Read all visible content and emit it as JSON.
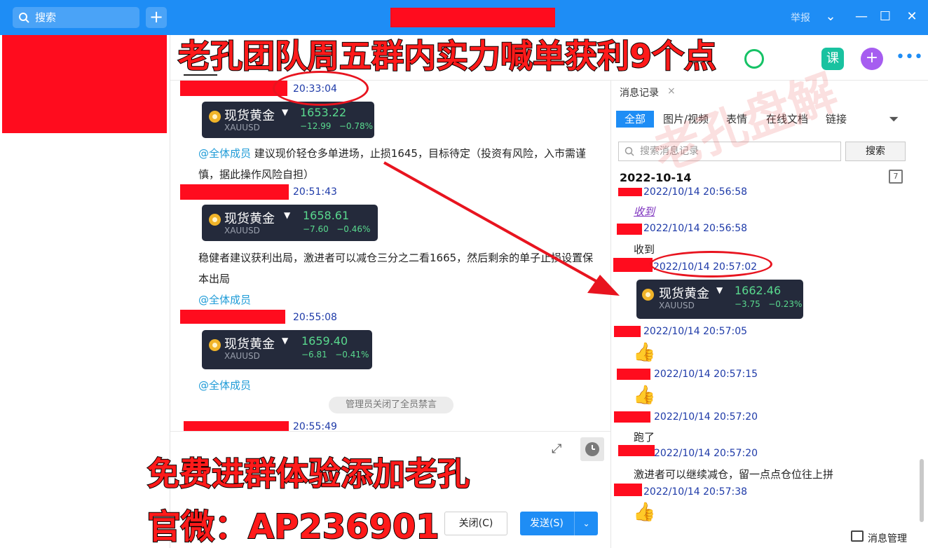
{
  "titlebar": {
    "search_label": "搜索",
    "add_label": "+",
    "report_label": "举报"
  },
  "banner": {
    "top": "老孔团队周五群内实力喊单获利9个点",
    "bottom1": "免费进群体验添加老孔",
    "bottom2": "官微：AP236901"
  },
  "watermark": "老孔盘解",
  "chat": {
    "ts1": "20:33:04",
    "card1": {
      "name": "现货黄金",
      "symbol": "XAUUSD",
      "price": "1653.22",
      "change": "−12.99",
      "pct": "−0.78%"
    },
    "msg1_at": "@全体成员",
    "msg1_text": " 建议现价轻仓多单进场，止损1645，目标待定（投资有风险，入市需谨慎，据此操作风险自担）",
    "ts2": "20:51:43",
    "card2": {
      "name": "现货黄金",
      "symbol": "XAUUSD",
      "price": "1658.61",
      "change": "−7.60",
      "pct": "−0.46%"
    },
    "msg2_text": "稳健者建议获利出局，激进者可以减仓三分之二看1665，然后剩余的单子止损设置保本出局",
    "msg2_at": "@全体成员",
    "ts3": "20:55:08",
    "card3": {
      "name": "现货黄金",
      "symbol": "XAUUSD",
      "price": "1659.40",
      "change": "−6.81",
      "pct": "−0.41%"
    },
    "msg3_at": "@全体成员",
    "system": "管理员关闭了全员禁言",
    "ts4": "20:55:49"
  },
  "composer": {
    "close_label": "关闭(C)",
    "send_label": "发送(S)"
  },
  "history": {
    "title": "消息记录",
    "close": "×",
    "tabs": [
      "全部",
      "图片/视频",
      "表情",
      "在线文档",
      "链接"
    ],
    "search_placeholder": "搜索消息记录",
    "search_button": "搜索",
    "date": "2022-10-14",
    "entries": [
      {
        "ts": "2022/10/14 20:56:58",
        "text": "收到"
      },
      {
        "ts": "2022/10/14 20:56:58",
        "text": "收到"
      },
      {
        "ts": "2022/10/14 20:57:02",
        "text": ""
      },
      {
        "ts": "2022/10/14 20:57:05",
        "text": "👍"
      },
      {
        "ts": "2022/10/14 20:57:15",
        "text": "👍"
      },
      {
        "ts": "2022/10/14 20:57:20",
        "text": "跑了"
      },
      {
        "ts": "2022/10/14 20:57:20",
        "text": "激进者可以继续减仓，留一点点仓位往上拼"
      },
      {
        "ts": "2022/10/14 20:57:38",
        "text": "👍"
      }
    ],
    "card": {
      "name": "现货黄金",
      "symbol": "XAUUSD",
      "price": "1662.46",
      "change": "−3.75",
      "pct": "−0.23%"
    },
    "manage": "消息管理"
  },
  "colors": {
    "titlebar": "#1e8df5",
    "redact": "#ff0c1e",
    "banner": "#ff1a1a",
    "price_green": "#59d98e"
  }
}
